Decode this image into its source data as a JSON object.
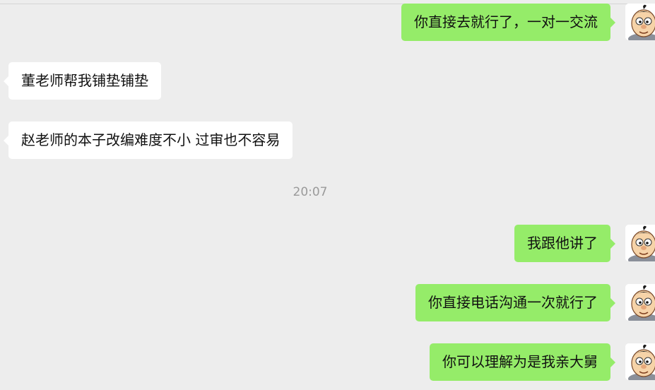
{
  "messages": [
    {
      "side": "right",
      "text": "你直接去就行了，一对一交流"
    },
    {
      "side": "left",
      "text": "董老师帮我铺垫铺垫"
    },
    {
      "side": "left",
      "text": "赵老师的本子改编难度不小  过审也不容易"
    },
    {
      "side": "right",
      "text": "我跟他讲了"
    },
    {
      "side": "right",
      "text": "你直接电话沟通一次就行了"
    },
    {
      "side": "right",
      "text": "你可以理解为是我亲大舅"
    }
  ],
  "timestamp": "20:07",
  "colors": {
    "background": "#ededed",
    "own_bubble": "#95ec69",
    "other_bubble": "#ffffff",
    "timestamp_text": "#9a9a9a"
  },
  "avatar_icon": "cartoon-boy-avatar-icon"
}
